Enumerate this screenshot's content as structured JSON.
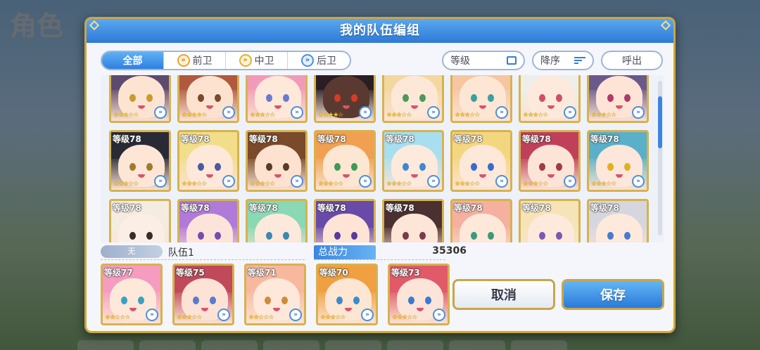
{
  "background": {
    "title": "角色"
  },
  "dialog": {
    "title": "我的队伍编组",
    "filter_tabs": [
      {
        "label": "全部",
        "icon": "none",
        "active": true
      },
      {
        "label": "前卫",
        "icon": "front-position-icon",
        "active": false
      },
      {
        "label": "中卫",
        "icon": "middle-position-icon",
        "active": false
      },
      {
        "label": "后卫",
        "icon": "rear-position-icon",
        "active": false
      }
    ],
    "sort_field": "等级",
    "sort_order": "降序",
    "call_out": "呼出"
  },
  "roster": [
    {
      "level": "",
      "stars": "★★★☆☆",
      "hair": "#5e4a6e",
      "skin": "#fde4d2",
      "eye": "#c89b2a"
    },
    {
      "level": "",
      "stars": "★★★★☆",
      "hair": "#b0593e",
      "skin": "#fde2d0",
      "eye": "#7a4a2a"
    },
    {
      "level": "",
      "stars": "★★★☆☆",
      "hair": "#f19bb8",
      "skin": "#fde8da",
      "eye": "#6a7ad0"
    },
    {
      "level": "",
      "stars": "★★★★☆",
      "hair": "#2a1d24",
      "skin": "#5a3a30",
      "eye": "#d83a2a"
    },
    {
      "level": "",
      "stars": "★★★☆☆",
      "hair": "#f3d7a0",
      "skin": "#fde8d8",
      "eye": "#4a9a5a"
    },
    {
      "level": "",
      "stars": "★★★☆☆",
      "hair": "#f5c6a0",
      "skin": "#fde6d4",
      "eye": "#3aa0a0"
    },
    {
      "level": "",
      "stars": "★★★☆☆",
      "hair": "#eeeeea",
      "skin": "#fdeadc",
      "eye": "#d05060"
    },
    {
      "level": "",
      "stars": "★★★☆☆",
      "hair": "#6a5a8a",
      "skin": "#fde4d6",
      "eye": "#b03a6a"
    },
    {
      "level": "等级78",
      "stars": "★★★☆☆",
      "hair": "#2a2a36",
      "skin": "#fde6d6",
      "eye": "#a07a2a"
    },
    {
      "level": "等级78",
      "stars": "★★★☆☆",
      "hair": "#f2de8a",
      "skin": "#fde8da",
      "eye": "#4a5aa0"
    },
    {
      "level": "等级78",
      "stars": "★★★☆☆",
      "hair": "#7a4a2a",
      "skin": "#fde2d0",
      "eye": "#5a3a2a"
    },
    {
      "level": "等级78",
      "stars": "★★★☆☆",
      "hair": "#f0a050",
      "skin": "#fde6d2",
      "eye": "#3a9a5a"
    },
    {
      "level": "等级78",
      "stars": "★★★☆☆",
      "hair": "#a8dff0",
      "skin": "#fdeadc",
      "eye": "#3a8ad0"
    },
    {
      "level": "等级78",
      "stars": "★★★☆☆",
      "hair": "#f5d680",
      "skin": "#fde8da",
      "eye": "#3a6ad0"
    },
    {
      "level": "等级78",
      "stars": "★★★☆☆",
      "hair": "#c0405a",
      "skin": "#fde4d6",
      "eye": "#a03a4a"
    },
    {
      "level": "等级78",
      "stars": "★★★☆☆",
      "hair": "#5ab0c8",
      "skin": "#fde6da",
      "eye": "#e0b020"
    },
    {
      "level": "等级78",
      "stars": "★★★☆☆",
      "hair": "#f4ece0",
      "skin": "#fbeee4",
      "eye": "#3a2a2a"
    },
    {
      "level": "等级78",
      "stars": "★★★☆☆",
      "hair": "#b07ad8",
      "skin": "#fde4da",
      "eye": "#7a4ab0"
    },
    {
      "level": "等级78",
      "stars": "★★★☆☆",
      "hair": "#8ad8b4",
      "skin": "#fde8dc",
      "eye": "#3a8ab0"
    },
    {
      "level": "等级78",
      "stars": "★★★☆☆",
      "hair": "#6a4aa8",
      "skin": "#fde4d6",
      "eye": "#5a3a9a"
    },
    {
      "level": "等级78",
      "stars": "★★★☆☆",
      "hair": "#4a3030",
      "skin": "#fde6d8",
      "eye": "#7a3a4a"
    },
    {
      "level": "等级78",
      "stars": "★★★☆☆",
      "hair": "#f5b0a0",
      "skin": "#fde8da",
      "eye": "#3a9a7a"
    },
    {
      "level": "等级78",
      "stars": "★★★☆☆",
      "hair": "#f6e4b8",
      "skin": "#fdeadc",
      "eye": "#7a5ab0"
    },
    {
      "level": "等级78",
      "stars": "★★★☆☆",
      "hair": "#d6d6de",
      "skin": "#fdeadc",
      "eye": "#4a7ad0"
    }
  ],
  "team": {
    "status_badge": "无",
    "name": "队伍1",
    "power_label": "总战力",
    "power_value": "35306",
    "members": [
      {
        "level": "等级77",
        "stars": "★★☆☆☆",
        "hair": "#f59cc0",
        "skin": "#fde8da",
        "eye": "#3aa0c0"
      },
      {
        "level": "等级75",
        "stars": "★★★☆☆",
        "hair": "#c04a5a",
        "skin": "#fde2d6",
        "eye": "#5a7ad0"
      },
      {
        "level": "等级71",
        "stars": "★★☆☆☆",
        "hair": "#f8b8a0",
        "skin": "#fde8da",
        "eye": "#d08a3a"
      },
      {
        "level": "等级70",
        "stars": "★★★☆☆",
        "hair": "#f0a040",
        "skin": "#fde6d2",
        "eye": "#3a8ad0"
      },
      {
        "level": "等级73",
        "stars": "★★★☆☆",
        "hair": "#e05a6a",
        "skin": "#fde4d8",
        "eye": "#3a7ad0"
      }
    ]
  },
  "buttons": {
    "cancel": "取消",
    "save": "保存"
  }
}
